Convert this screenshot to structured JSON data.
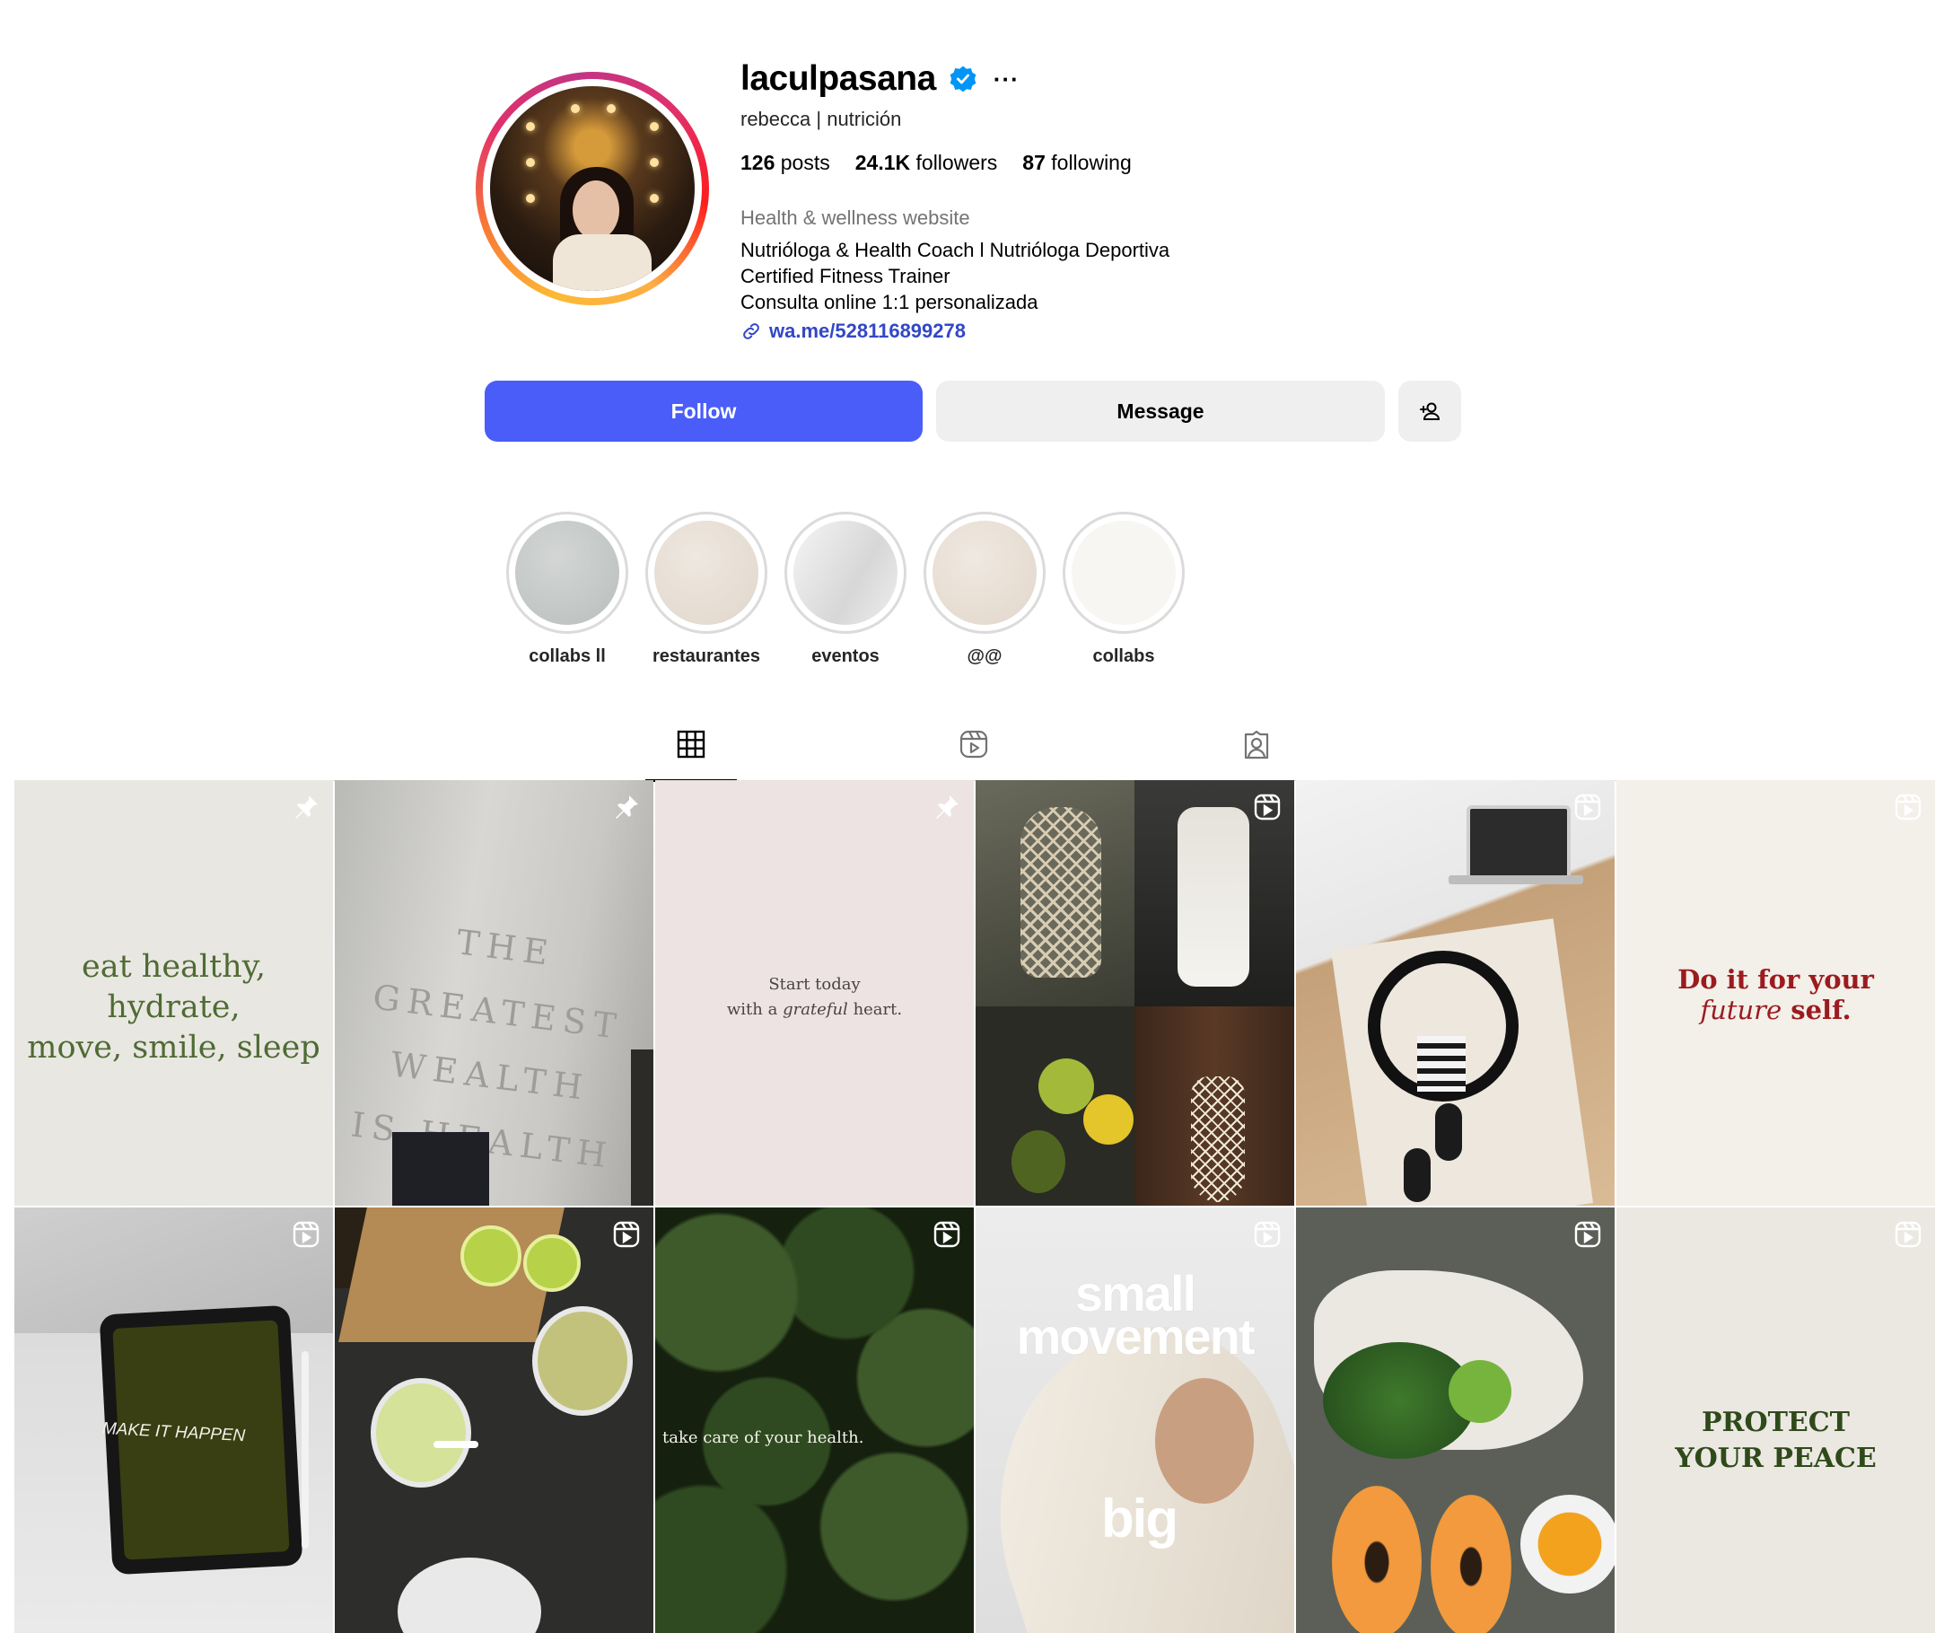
{
  "profile": {
    "username": "laculpasana",
    "full_name": "rebecca | nutrición",
    "posts_count": "126",
    "posts_label": "posts",
    "followers_count": "24.1K",
    "followers_label": "followers",
    "following_count": "87",
    "following_label": "following",
    "category": "Health & wellness website",
    "bio_lines": [
      "Nutrióloga & Health Coach l Nutrióloga Deportiva",
      "Certified Fitness Trainer",
      "Consulta online 1:1 personalizada"
    ],
    "link": "wa.me/528116899278",
    "more": "···"
  },
  "actions": {
    "follow_label": "Follow",
    "message_label": "Message",
    "add_user_icon": "person-add-icon"
  },
  "highlights": [
    {
      "label": "collabs ll",
      "color": "#c9cdcb"
    },
    {
      "label": "restaurantes",
      "color": "#e9e1d8"
    },
    {
      "label": "eventos",
      "color": "#e4e4e4"
    },
    {
      "label": "@@",
      "color": "#eae3da"
    },
    {
      "label": "collabs",
      "color": "#f6f5f1"
    }
  ],
  "tabs": [
    {
      "name": "posts",
      "icon": "grid-icon",
      "active": true
    },
    {
      "name": "reels",
      "icon": "reels-icon",
      "active": false
    },
    {
      "name": "tagged",
      "icon": "tagged-icon",
      "active": false
    }
  ],
  "posts": [
    {
      "badge": "pin-icon",
      "text": [
        "eat healthy, hydrate,",
        "move, smile, sleep"
      ]
    },
    {
      "badge": "pin-icon",
      "text": [
        "THE GREATEST WEALTH",
        "IS HEALTH"
      ]
    },
    {
      "badge": "pin-icon",
      "text": [
        "Start today",
        "with a",
        "grateful",
        "heart."
      ]
    },
    {
      "badge": "reel-icon",
      "text": []
    },
    {
      "badge": "reel-icon",
      "text": []
    },
    {
      "badge": "reel-icon",
      "text": [
        "Do it for your",
        "future",
        "self."
      ]
    },
    {
      "badge": "reel-icon",
      "text": [
        "MAKE IT HAPPEN"
      ]
    },
    {
      "badge": "reel-icon",
      "text": []
    },
    {
      "badge": "reel-icon",
      "text": [
        "take care of your health."
      ]
    },
    {
      "badge": "reel-icon",
      "text": [
        "small",
        "movement",
        "big"
      ]
    },
    {
      "badge": "reel-icon",
      "text": []
    },
    {
      "badge": "reel-icon",
      "text": [
        "PROTECT",
        "YOUR PEACE"
      ]
    }
  ],
  "colors": {
    "follow_button": "#4a5df9",
    "link": "#3347c8",
    "verified": "#0095f6",
    "green_text": "#4f6b34",
    "red_text": "#9b1b1f"
  }
}
